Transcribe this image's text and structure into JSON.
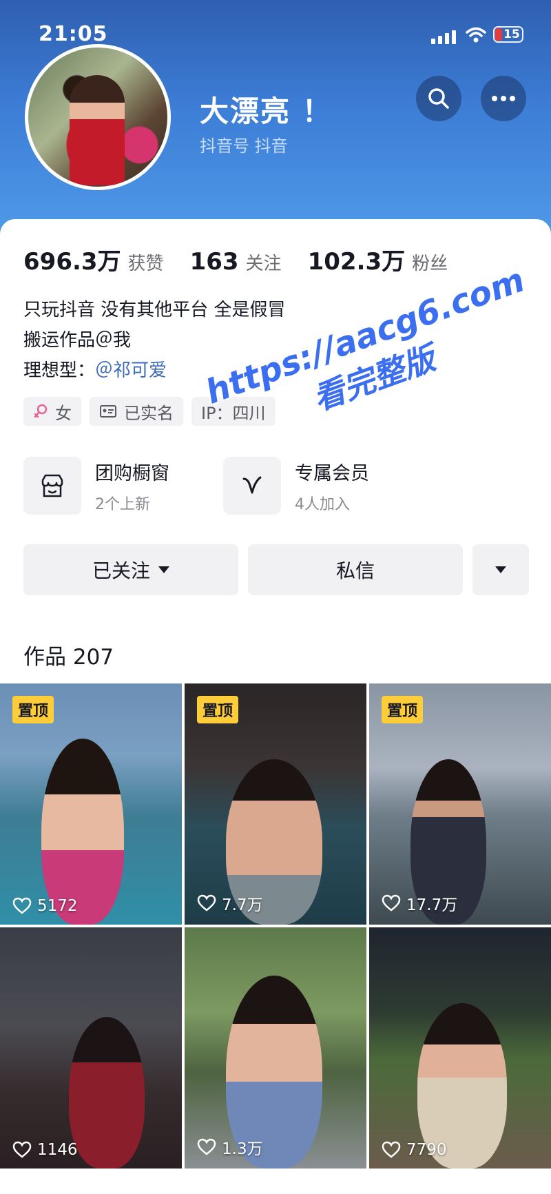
{
  "status_bar": {
    "time": "21:05",
    "battery": "15"
  },
  "profile": {
    "name": "大漂亮 ！",
    "douyin_id": "抖音号 抖音"
  },
  "stats": [
    {
      "value": "696.3万",
      "label": "获赞"
    },
    {
      "value": "163",
      "label": "关注"
    },
    {
      "value": "102.3万",
      "label": "粉丝"
    }
  ],
  "bio": {
    "line1": "只玩抖音 没有其他平台 全是假冒",
    "line2": "搬运作品＠我",
    "line3_prefix": "理想型：",
    "line3_mention": "＠祁可爱"
  },
  "tags": {
    "gender": "女",
    "verified": "已实名",
    "ip": "IP：四川"
  },
  "shop_cards": [
    {
      "title": "团购橱窗",
      "subtitle": "2个上新",
      "icon": "store-icon"
    },
    {
      "title": "专属会员",
      "subtitle": "4人加入",
      "icon": "v-member-icon"
    }
  ],
  "actions": {
    "follow": "已关注",
    "message": "私信"
  },
  "works": {
    "label": "作品 207",
    "pinned_label": "置顶",
    "items": [
      {
        "likes": "5172",
        "pinned": true
      },
      {
        "likes": "7.7万",
        "pinned": true
      },
      {
        "likes": "17.7万",
        "pinned": true
      },
      {
        "likes": "1146",
        "pinned": false
      },
      {
        "likes": "1.3万",
        "pinned": false
      },
      {
        "likes": "7790",
        "pinned": false
      }
    ]
  },
  "watermark": {
    "line1": "https://aacg6.com",
    "line2": "看完整版"
  },
  "colors": {
    "header_blue": "#3c7dd6",
    "mention_blue": "#3e6bb8",
    "pin_yellow": "#ffcc3a",
    "watermark_blue": "#3b6ff0"
  }
}
